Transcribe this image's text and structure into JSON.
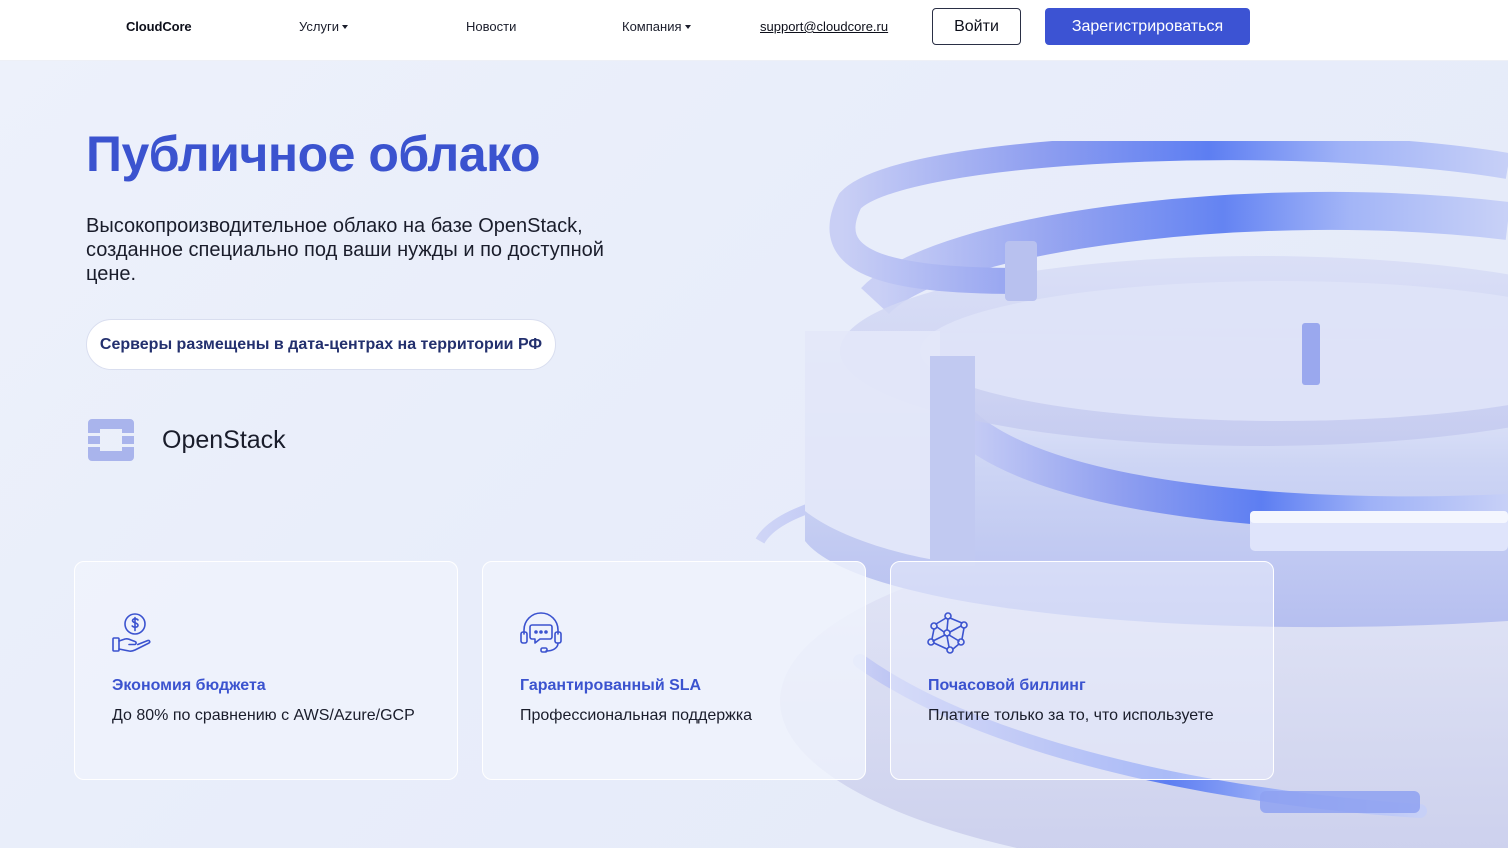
{
  "header": {
    "logo": "CloudCore",
    "nav": {
      "services": "Услуги",
      "news": "Новости",
      "company": "Компания",
      "email": "support@cloudcore.ru"
    },
    "login_label": "Войти",
    "register_label": "Зарегистрироваться"
  },
  "hero": {
    "title": "Публичное облако",
    "subtitle": "Высокопроизводительное облако на базе OpenStack, созданное специально под ваши нужды и по доступной цене.",
    "pill": "Серверы размещены в дата-центрах на территории РФ",
    "openstack_label": "OpenStack"
  },
  "features": [
    {
      "icon": "money-hand-icon",
      "title": "Экономия бюджета",
      "text": "До 80% по сравнению с AWS/Azure/GCP"
    },
    {
      "icon": "headset-chat-icon",
      "title": "Гарантированный SLA",
      "text": "Профессиональная поддержка"
    },
    {
      "icon": "network-nodes-icon",
      "title": "Почасовой биллинг",
      "text": "Платите только за то, что используете"
    }
  ],
  "colors": {
    "accent": "#3b53cf",
    "button_primary": "#3c53d3",
    "hero_bg": "#e8edfa",
    "openstack_logo": "#a9b4ec"
  }
}
